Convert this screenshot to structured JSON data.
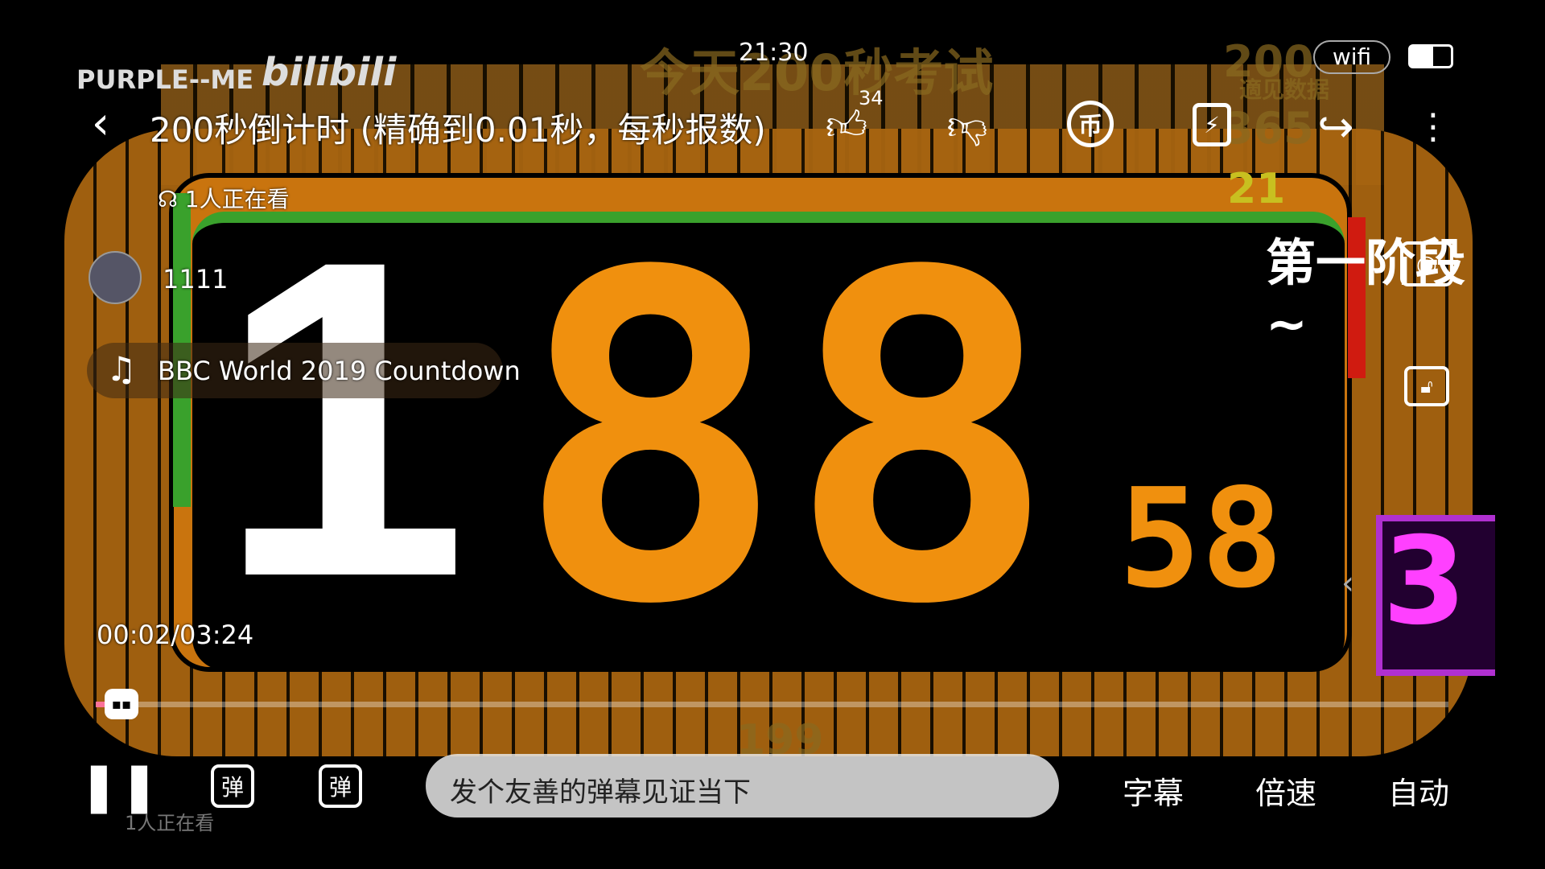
{
  "status_bar": {
    "time": "21:30",
    "wifi": "wifi",
    "battery_level": 0.6
  },
  "watermark": {
    "channel": "PURPLE--ME",
    "logo": "bilibili"
  },
  "video": {
    "overlay_title": "今天200秒考试",
    "counter_big_prefix": "1",
    "counter_digits": "88",
    "counter_lead": "1",
    "counter_fraction": "58",
    "stage_label": "第一阶段~",
    "side_number": "21",
    "top_right_number": "200",
    "top_right_caption": "適见数据",
    "top_right_sub": "365",
    "bottom_ghost": "199",
    "pink_digits": "3"
  },
  "header": {
    "title": "200秒倒计时 (精确到0.01秒，每秒报数)",
    "like_count": "34"
  },
  "overlay": {
    "viewers": "1人正在看",
    "user_name": "1111",
    "music": "BBC World 2019 Countdown",
    "viewers_bottom": "1人正在看"
  },
  "player": {
    "time": "00:02/03:24",
    "progress": 0.01
  },
  "bottom": {
    "danmaku_placeholder": "发个友善的弹幕见证当下",
    "subtitle": "字幕",
    "speed": "倍速",
    "quality": "自动",
    "danmaku_on": "弹",
    "danmaku_settings": "弹"
  }
}
